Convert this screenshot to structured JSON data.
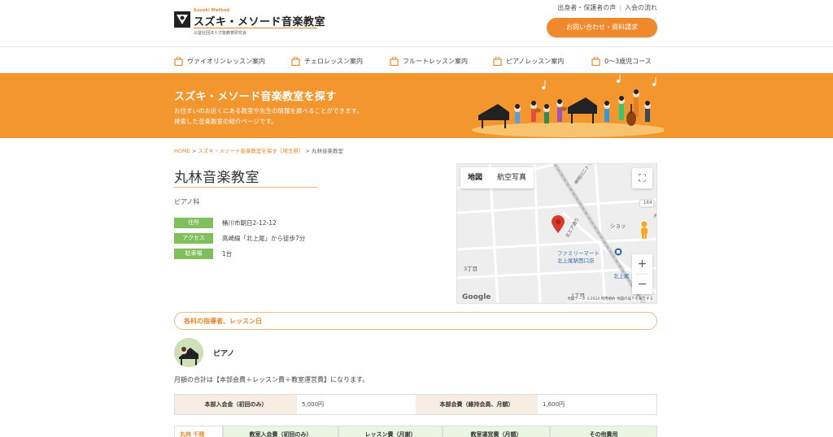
{
  "header": {
    "logo": {
      "top_text": "Suzuki Method",
      "title": "スズキ・メソード音楽教室",
      "subtitle": "公益社団法人才能教育研究会"
    },
    "top_links": [
      "出身者・保護者の声",
      "入会の流れ"
    ],
    "cta_label": "お問い合わせ・資料請求"
  },
  "nav": {
    "items": [
      {
        "label": "ヴァイオリンレッスン案内"
      },
      {
        "label": "チェロレッスン案内"
      },
      {
        "label": "フルートレッスン案内"
      },
      {
        "label": "ピアノレッスン案内"
      },
      {
        "label": "0〜3歳児コース"
      }
    ]
  },
  "banner": {
    "title": "スズキ・メソード音楽教室を探す",
    "lines": [
      "お住まいのお近くにある教室や先生の情報を調べることができます。",
      "検索した音楽教室の紹介ページです。"
    ]
  },
  "breadcrumb": {
    "home": "HOME",
    "sep": ">",
    "search": "スズキ・メソード音楽教室を探す［埼玉県］",
    "current": "丸林音楽教室"
  },
  "classroom": {
    "name": "丸林音楽教室",
    "subject": "ピアノ科",
    "info": [
      {
        "label": "住所",
        "value": "桶川市朝日2-12-12"
      },
      {
        "label": "アクセス",
        "value": "高崎線「北上尾」から徒歩7分"
      },
      {
        "label": "駐車場",
        "value": "1台"
      }
    ]
  },
  "map": {
    "tabs": [
      "地図",
      "航空写真"
    ],
    "zoom_in": "+",
    "zoom_out": "−",
    "labels": {
      "station_1": "ファミリーマート",
      "station_2": "北上尾駅西口店",
      "area_1": "3丁目",
      "area_2": "1丁目",
      "shop": "ショッ",
      "kita": "北上尾",
      "road": "164",
      "road2": "神明川ニトラスキ通り",
      "road3": "北エア通り",
      "p": "P"
    },
    "google": "Google",
    "footer": "地図データ ©2024   利用規約   地図の誤りを報告する"
  },
  "section": {
    "title": "各科の指導者、レッスン日",
    "instrument": "ピアノ",
    "fee_note": "月額の合計は【本部会費＋レッスン費＋教室運営費】になります。",
    "fee_table": {
      "h1": "本部入会金（初回のみ）",
      "v1": "5,000円",
      "h2": "本部会費（維持会員、月額）",
      "v2": "1,600円"
    },
    "table2": {
      "c1": "丸林 千晴",
      "c2": "教室入会費（初回のみ）",
      "c3": "レッスン費（月謝）",
      "c4": "教室運営費（月額）",
      "c5": "その他費用"
    }
  },
  "colors": {
    "accent": "#f0892b",
    "banner": "#f3962e",
    "label_green": "#7fbf5c"
  }
}
